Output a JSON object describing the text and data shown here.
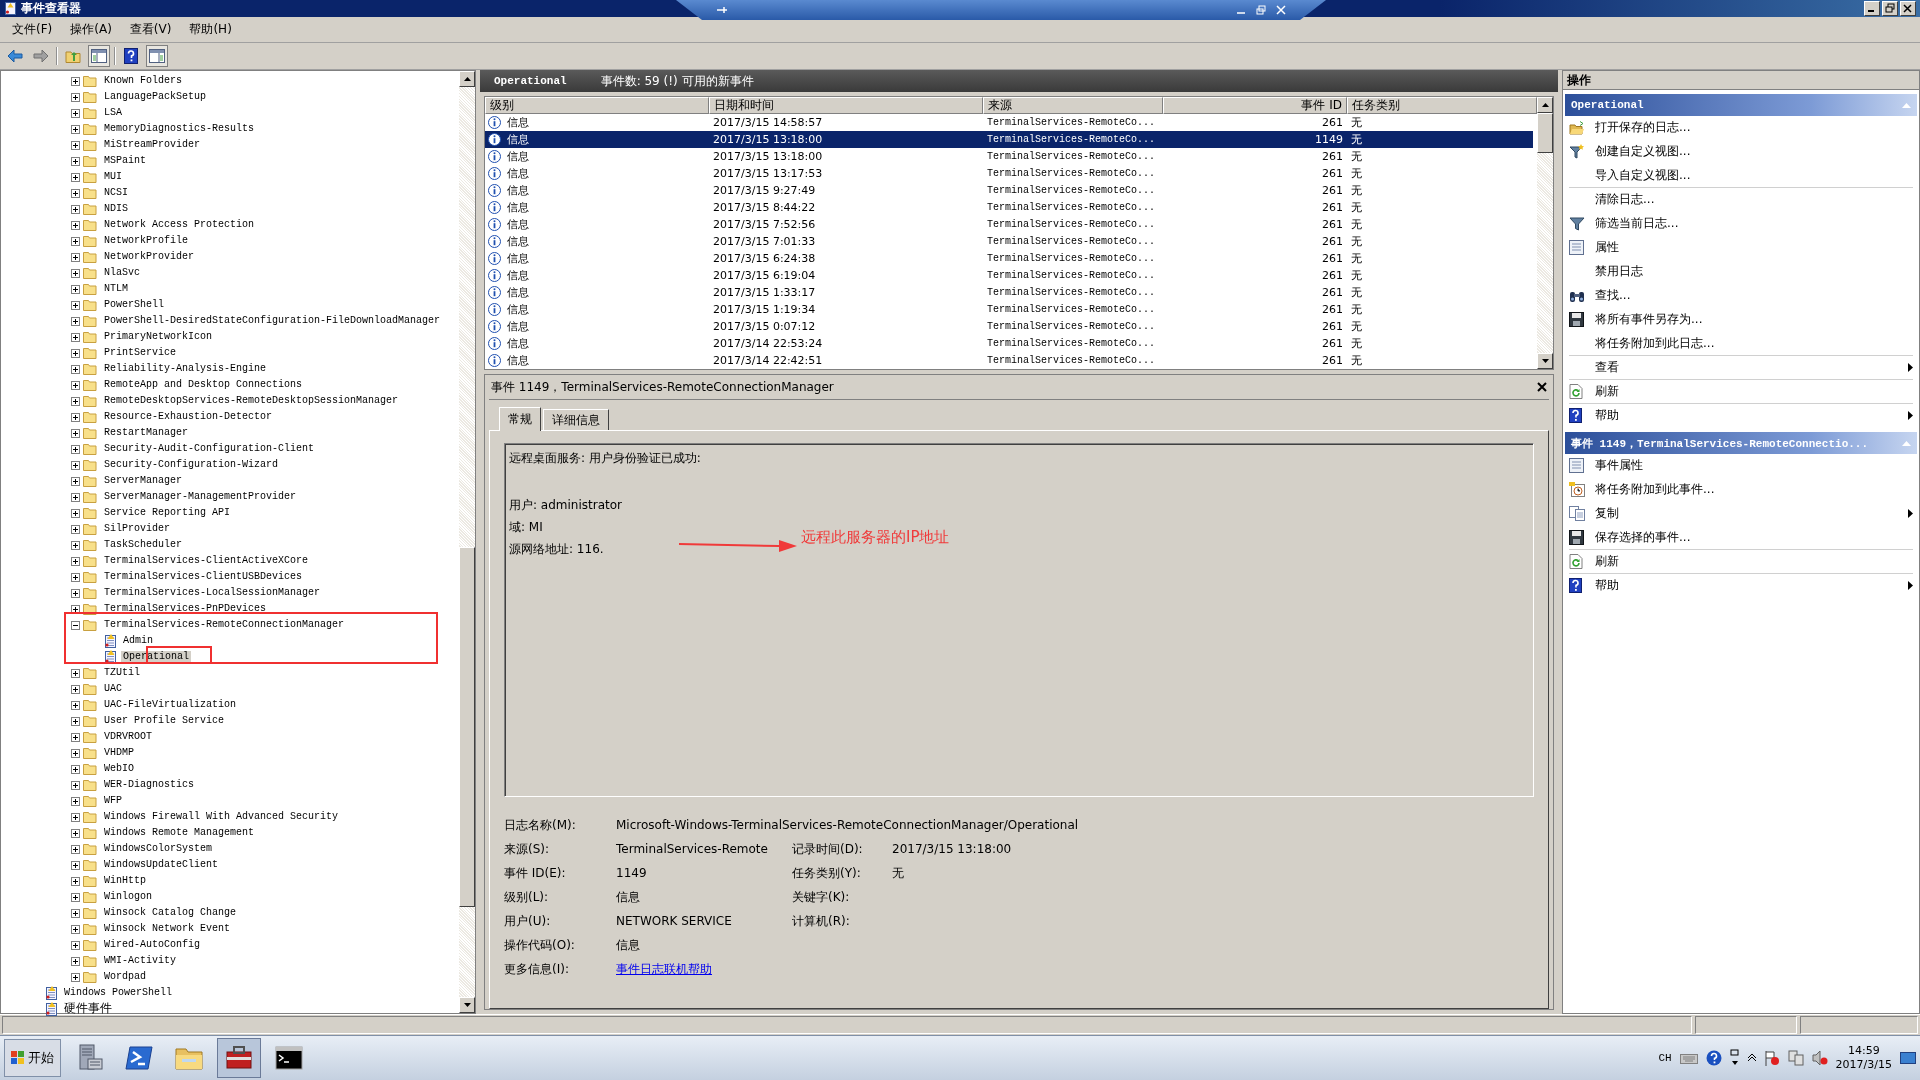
{
  "window": {
    "title": "事件查看器"
  },
  "menu": [
    "文件(F)",
    "操作(A)",
    "查看(V)",
    "帮助(H)"
  ],
  "toolbar": [
    {
      "kind": "back"
    },
    {
      "kind": "forward"
    },
    {
      "kind": "up"
    },
    {
      "kind": "tree"
    },
    {
      "kind": "help"
    },
    {
      "kind": "actions"
    }
  ],
  "tree": {
    "branch": [
      {
        "label": "Known Folders",
        "expanded": false
      },
      {
        "label": "LanguagePackSetup",
        "expanded": false
      },
      {
        "label": "LSA",
        "expanded": false
      },
      {
        "label": "MemoryDiagnostics-Results",
        "expanded": false
      },
      {
        "label": "MiStreamProvider",
        "expanded": false
      },
      {
        "label": "MSPaint",
        "expanded": false
      },
      {
        "label": "MUI",
        "expanded": false
      },
      {
        "label": "NCSI",
        "expanded": false
      },
      {
        "label": "NDIS",
        "expanded": false
      },
      {
        "label": "Network Access Protection",
        "expanded": false
      },
      {
        "label": "NetworkProfile",
        "expanded": false
      },
      {
        "label": "NetworkProvider",
        "expanded": false
      },
      {
        "label": "NlaSvc",
        "expanded": false
      },
      {
        "label": "NTLM",
        "expanded": false
      },
      {
        "label": "PowerShell",
        "expanded": false
      },
      {
        "label": "PowerShell-DesiredStateConfiguration-FileDownloadManager",
        "expanded": false
      },
      {
        "label": "PrimaryNetworkIcon",
        "expanded": false
      },
      {
        "label": "PrintService",
        "expanded": false
      },
      {
        "label": "Reliability-Analysis-Engine",
        "expanded": false
      },
      {
        "label": "RemoteApp and Desktop Connections",
        "expanded": false
      },
      {
        "label": "RemoteDesktopServices-RemoteDesktopSessionManager",
        "expanded": false
      },
      {
        "label": "Resource-Exhaustion-Detector",
        "expanded": false
      },
      {
        "label": "RestartManager",
        "expanded": false
      },
      {
        "label": "Security-Audit-Configuration-Client",
        "expanded": false
      },
      {
        "label": "Security-Configuration-Wizard",
        "expanded": false
      },
      {
        "label": "ServerManager",
        "expanded": false
      },
      {
        "label": "ServerManager-ManagementProvider",
        "expanded": false
      },
      {
        "label": "Service Reporting API",
        "expanded": false
      },
      {
        "label": "SilProvider",
        "expanded": false
      },
      {
        "label": "TaskScheduler",
        "expanded": false
      },
      {
        "label": "TerminalServices-ClientActiveXCore",
        "expanded": false
      },
      {
        "label": "TerminalServices-ClientUSBDevices",
        "expanded": false
      },
      {
        "label": "TerminalServices-LocalSessionManager",
        "expanded": false
      },
      {
        "label": "TerminalServices-PnPDevices",
        "expanded": false
      },
      {
        "label": "TerminalServices-RemoteConnectionManager",
        "expanded": true,
        "children": [
          {
            "label": "Admin",
            "selected": false
          },
          {
            "label": "Operational",
            "selected": true
          }
        ]
      },
      {
        "label": "TZUtil",
        "expanded": false
      },
      {
        "label": "UAC",
        "expanded": false
      },
      {
        "label": "UAC-FileVirtualization",
        "expanded": false
      },
      {
        "label": "User Profile Service",
        "expanded": false
      },
      {
        "label": "VDRVROOT",
        "expanded": false
      },
      {
        "label": "VHDMP",
        "expanded": false
      },
      {
        "label": "WebIO",
        "expanded": false
      },
      {
        "label": "WER-Diagnostics",
        "expanded": false
      },
      {
        "label": "WFP",
        "expanded": false
      },
      {
        "label": "Windows Firewall With Advanced Security",
        "expanded": false
      },
      {
        "label": "Windows Remote Management",
        "expanded": false
      },
      {
        "label": "WindowsColorSystem",
        "expanded": false
      },
      {
        "label": "WindowsUpdateClient",
        "expanded": false
      },
      {
        "label": "WinHttp",
        "expanded": false
      },
      {
        "label": "Winlogon",
        "expanded": false
      },
      {
        "label": "Winsock Catalog Change",
        "expanded": false
      },
      {
        "label": "Winsock Network Event",
        "expanded": false
      },
      {
        "label": "Wired-AutoConfig",
        "expanded": false
      },
      {
        "label": "WMI-Activity",
        "expanded": false
      },
      {
        "label": "Wordpad",
        "expanded": false
      }
    ],
    "logs": [
      {
        "label": "Windows PowerShell"
      },
      {
        "label": "硬件事件"
      }
    ]
  },
  "events": {
    "log_name": "Operational",
    "count": "事件数: 59 (!) 可用的新事件",
    "columns": [
      "级别",
      "日期和时间",
      "来源",
      "事件 ID",
      "任务类别"
    ],
    "rows": [
      {
        "level": "信息",
        "date": "2017/3/15 14:58:57",
        "source": "TerminalServices-RemoteCo...",
        "id": "261",
        "task": "无",
        "selected": false
      },
      {
        "level": "信息",
        "date": "2017/3/15 13:18:00",
        "source": "TerminalServices-RemoteCo...",
        "id": "1149",
        "task": "无",
        "selected": true
      },
      {
        "level": "信息",
        "date": "2017/3/15 13:18:00",
        "source": "TerminalServices-RemoteCo...",
        "id": "261",
        "task": "无",
        "selected": false
      },
      {
        "level": "信息",
        "date": "2017/3/15 13:17:53",
        "source": "TerminalServices-RemoteCo...",
        "id": "261",
        "task": "无",
        "selected": false
      },
      {
        "level": "信息",
        "date": "2017/3/15 9:27:49",
        "source": "TerminalServices-RemoteCo...",
        "id": "261",
        "task": "无",
        "selected": false
      },
      {
        "level": "信息",
        "date": "2017/3/15 8:44:22",
        "source": "TerminalServices-RemoteCo...",
        "id": "261",
        "task": "无",
        "selected": false
      },
      {
        "level": "信息",
        "date": "2017/3/15 7:52:56",
        "source": "TerminalServices-RemoteCo...",
        "id": "261",
        "task": "无",
        "selected": false
      },
      {
        "level": "信息",
        "date": "2017/3/15 7:01:33",
        "source": "TerminalServices-RemoteCo...",
        "id": "261",
        "task": "无",
        "selected": false
      },
      {
        "level": "信息",
        "date": "2017/3/15 6:24:38",
        "source": "TerminalServices-RemoteCo...",
        "id": "261",
        "task": "无",
        "selected": false
      },
      {
        "level": "信息",
        "date": "2017/3/15 6:19:04",
        "source": "TerminalServices-RemoteCo...",
        "id": "261",
        "task": "无",
        "selected": false
      },
      {
        "level": "信息",
        "date": "2017/3/15 1:33:17",
        "source": "TerminalServices-RemoteCo...",
        "id": "261",
        "task": "无",
        "selected": false
      },
      {
        "level": "信息",
        "date": "2017/3/15 1:19:34",
        "source": "TerminalServices-RemoteCo...",
        "id": "261",
        "task": "无",
        "selected": false
      },
      {
        "level": "信息",
        "date": "2017/3/15 0:07:12",
        "source": "TerminalServices-RemoteCo...",
        "id": "261",
        "task": "无",
        "selected": false
      },
      {
        "level": "信息",
        "date": "2017/3/14 22:53:24",
        "source": "TerminalServices-RemoteCo...",
        "id": "261",
        "task": "无",
        "selected": false
      },
      {
        "level": "信息",
        "date": "2017/3/14 22:42:51",
        "source": "TerminalServices-RemoteCo...",
        "id": "261",
        "task": "无",
        "selected": false
      }
    ]
  },
  "detail": {
    "title": "事件 1149，TerminalServices-RemoteConnectionManager",
    "tabs": [
      {
        "label": "常规",
        "selected": true
      },
      {
        "label": "详细信息",
        "selected": false
      }
    ],
    "heading": "远程桌面服务: 用户身份验证已成功:",
    "lines": [
      "用户: administrator",
      "域: MI",
      "源网络地址: 116."
    ],
    "annotation": "远程此服务器的IP地址",
    "properties": [
      {
        "cells": [
          {
            "label": "日志名称(M):",
            "value": "Microsoft-Windows-TerminalServices-RemoteConnectionManager/Operational"
          }
        ]
      },
      {
        "cells": [
          {
            "label": "来源(S):",
            "value": "TerminalServices-Remote"
          },
          {
            "label": "记录时间(D):",
            "value": "2017/3/15 13:18:00"
          }
        ]
      },
      {
        "cells": [
          {
            "label": "事件 ID(E):",
            "value": "1149"
          },
          {
            "label": "任务类别(Y):",
            "value": "无"
          }
        ]
      },
      {
        "cells": [
          {
            "label": "级别(L):",
            "value": "信息"
          },
          {
            "label": "关键字(K):"
          }
        ]
      },
      {
        "cells": [
          {
            "label": "用户(U):",
            "value": "NETWORK SERVICE"
          },
          {
            "label": "计算机(R):"
          }
        ]
      },
      {
        "cells": [
          {
            "label": "操作代码(O):",
            "value": "信息"
          }
        ]
      },
      {
        "cells": [
          {
            "label": "更多信息(I):",
            "value": "事件日志联机帮助",
            "kind": "link"
          }
        ]
      }
    ]
  },
  "actions": {
    "title": "操作",
    "sections": [
      {
        "title": "Operational",
        "items": [
          {
            "label": "打开保存的日志...",
            "kind": "open",
            "submenu": false,
            "divider": false
          },
          {
            "label": "创建自定义视图...",
            "kind": "newfilter",
            "submenu": false,
            "divider": false
          },
          {
            "label": "导入自定义视图...",
            "kind": "none",
            "submenu": false,
            "divider": true
          },
          {
            "label": "清除日志...",
            "kind": "none",
            "submenu": false,
            "divider": false
          },
          {
            "label": "筛选当前日志...",
            "kind": "filter",
            "submenu": false,
            "divider": false
          },
          {
            "label": "属性",
            "kind": "props",
            "submenu": false,
            "divider": false
          },
          {
            "label": "禁用日志",
            "kind": "none",
            "submenu": false,
            "divider": false
          },
          {
            "label": "查找...",
            "kind": "find",
            "submenu": false,
            "divider": false
          },
          {
            "label": "将所有事件另存为...",
            "kind": "save",
            "submenu": false,
            "divider": false
          },
          {
            "label": "将任务附加到此日志...",
            "kind": "none",
            "submenu": false,
            "divider": true
          },
          {
            "label": "查看",
            "kind": "none",
            "submenu": true,
            "divider": true
          },
          {
            "label": "刷新",
            "kind": "refresh",
            "submenu": false,
            "divider": true
          },
          {
            "label": "帮助",
            "kind": "help",
            "submenu": true,
            "divider": false
          }
        ]
      },
      {
        "title": "事件 1149，TerminalServices-RemoteConnectio...",
        "items": [
          {
            "label": "事件属性",
            "kind": "props",
            "submenu": false,
            "divider": false
          },
          {
            "label": "将任务附加到此事件...",
            "kind": "task",
            "submenu": false,
            "divider": false
          },
          {
            "label": "复制",
            "kind": "copy",
            "submenu": true,
            "divider": false
          },
          {
            "label": "保存选择的事件...",
            "kind": "save",
            "submenu": false,
            "divider": true
          },
          {
            "label": "刷新",
            "kind": "refresh",
            "submenu": false,
            "divider": true
          },
          {
            "label": "帮助",
            "kind": "help",
            "submenu": true,
            "divider": false
          }
        ]
      }
    ]
  },
  "taskbar": {
    "start": "开始",
    "apps": [
      {
        "kind": "server",
        "active": false
      },
      {
        "kind": "shell",
        "active": false
      },
      {
        "kind": "folder",
        "active": false
      },
      {
        "kind": "toolbox",
        "active": true
      },
      {
        "kind": "console",
        "active": false
      }
    ],
    "language": "CH",
    "time": "14:59",
    "date": "2017/3/15"
  }
}
